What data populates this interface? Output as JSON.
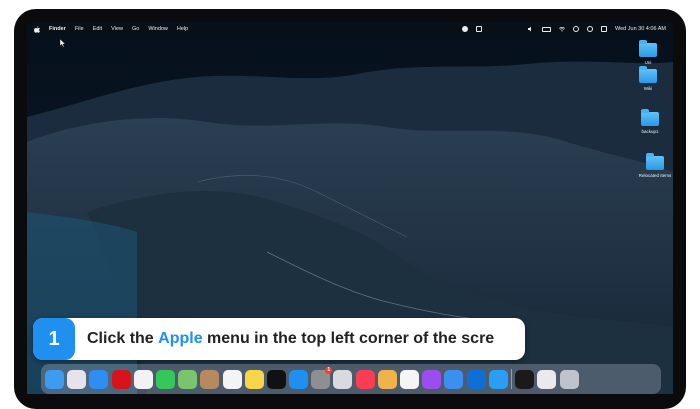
{
  "menubar": {
    "app_name": "Finder",
    "items": [
      "File",
      "Edit",
      "View",
      "Go",
      "Window",
      "Help"
    ],
    "clock": "Wed Jun 30  4:06 AM"
  },
  "desktop": {
    "icons": [
      {
        "label": "Uni",
        "icon": "folder-icon"
      },
      {
        "label": "Wiki",
        "icon": "folder-icon"
      },
      {
        "label": "backup1",
        "icon": "folder-icon"
      },
      {
        "label": "Relocated Items",
        "icon": "folder-icon"
      }
    ]
  },
  "banner": {
    "step": "1",
    "text_before": "Click the ",
    "highlight": "Apple",
    "text_after": " menu in the top left corner of the scre"
  },
  "dock": {
    "apps": [
      {
        "name": "finder-icon",
        "color": "#3d9cf0"
      },
      {
        "name": "launchpad-icon",
        "color": "#e4e4ea"
      },
      {
        "name": "safari-icon",
        "color": "#2f8ef2"
      },
      {
        "name": "opera-icon",
        "color": "#d8141b"
      },
      {
        "name": "chrome-icon",
        "color": "#f2f2f2"
      },
      {
        "name": "messages-icon",
        "color": "#34c759"
      },
      {
        "name": "maps-icon",
        "color": "#7ac46d"
      },
      {
        "name": "contacts-icon",
        "color": "#b58a5c"
      },
      {
        "name": "reminders-icon",
        "color": "#f4f4f4"
      },
      {
        "name": "notes-icon",
        "color": "#f7d64a"
      },
      {
        "name": "apple-tv-icon",
        "color": "#111111"
      },
      {
        "name": "app-store-icon",
        "color": "#1f8ff0"
      },
      {
        "name": "system-preferences-icon",
        "color": "#8e8e93",
        "badge": "1"
      },
      {
        "name": "preview-icon",
        "color": "#d9d9de"
      },
      {
        "name": "music-icon",
        "color": "#fa3c55"
      },
      {
        "name": "pages-icon",
        "color": "#f0b24a"
      },
      {
        "name": "photos-icon",
        "color": "#f5f5f5"
      },
      {
        "name": "podcasts-icon",
        "color": "#9b4df0"
      },
      {
        "name": "mail-icon",
        "color": "#3a8ff0"
      },
      {
        "name": "teamviewer-icon",
        "color": "#0e6fd6"
      },
      {
        "name": "mk-app-icon",
        "color": "#2a9df4"
      },
      {
        "name": "cloud-icon",
        "color": "#1a1a1a"
      },
      {
        "name": "document-icon",
        "color": "#e9e9ee"
      },
      {
        "name": "trash-icon",
        "color": "#bfc4cc"
      }
    ]
  }
}
